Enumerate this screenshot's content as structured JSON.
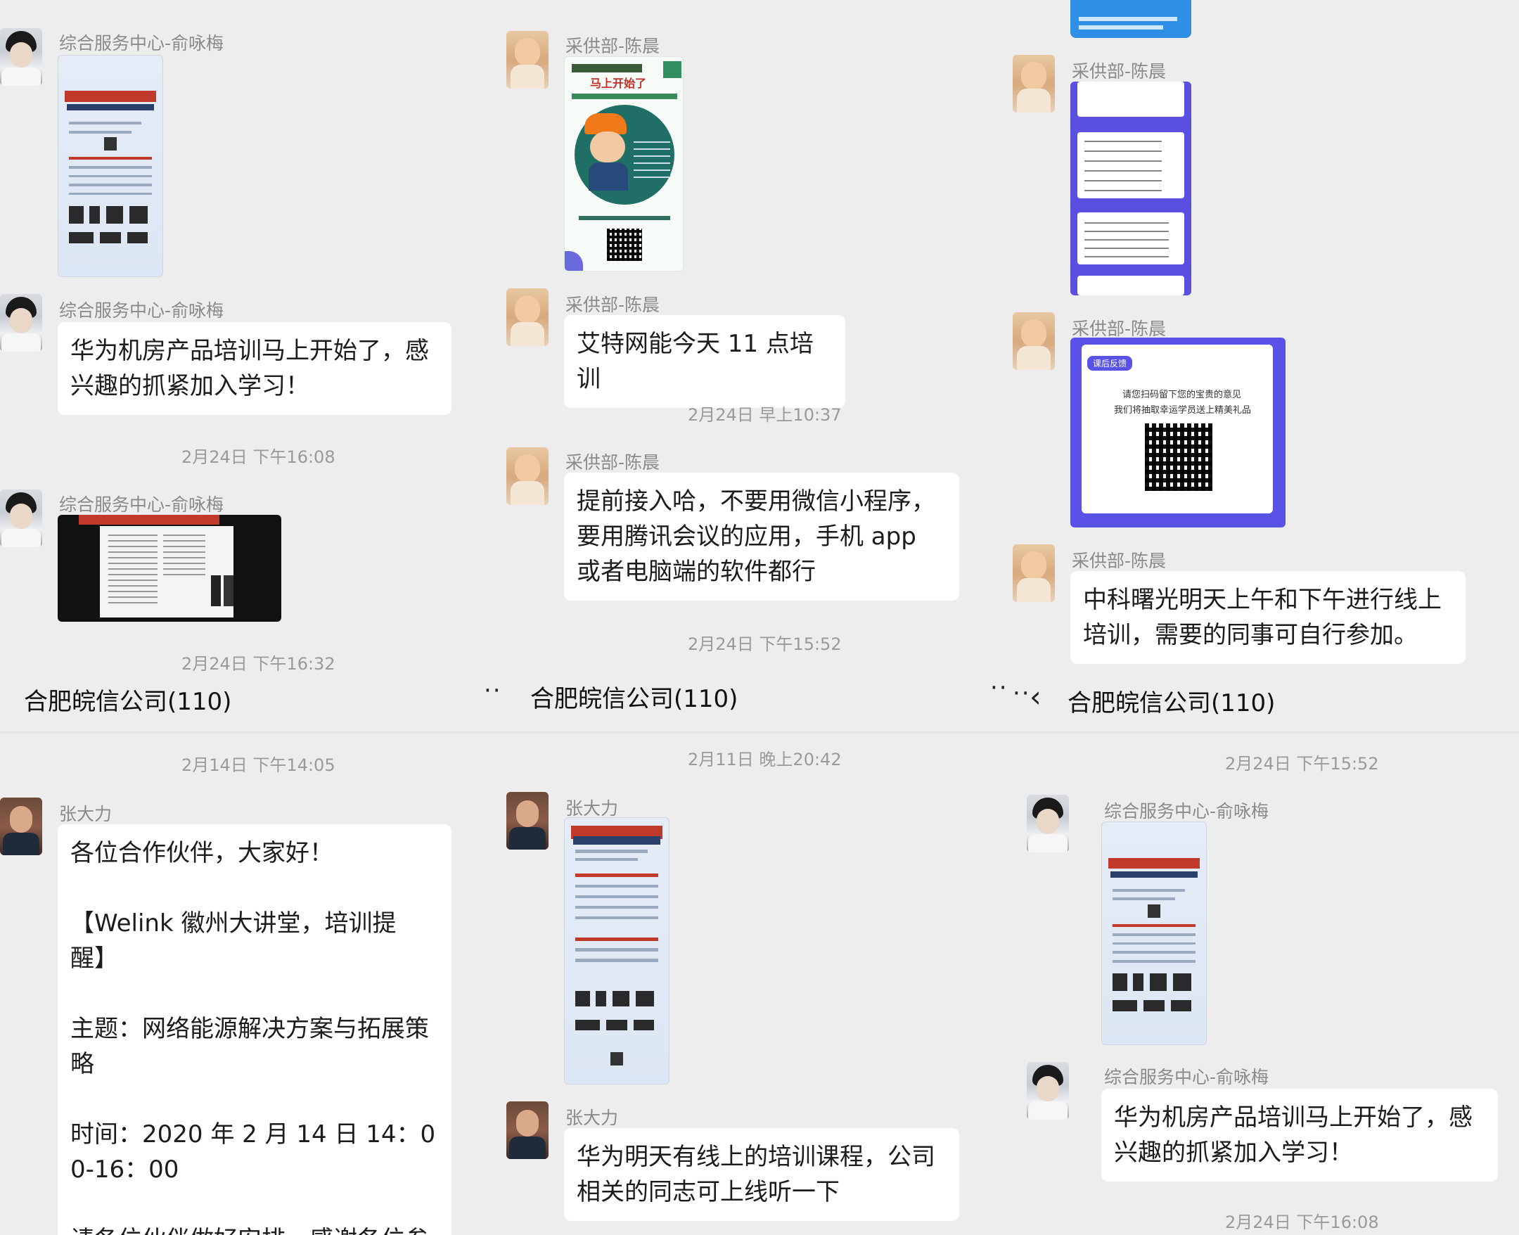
{
  "group_title": "合肥皖信公司(110)",
  "senders": {
    "yu": "综合服务中心-俞咏梅",
    "chen": "采供部-陈晨",
    "zhang": "张大力"
  },
  "panel_tl": {
    "msg_text": "华为机房产品培训马上开始了，感兴趣的抓紧加入学习！",
    "time1": "2月24日 下午16:08",
    "time2": "2月24日 下午16:32"
  },
  "panel_tm": {
    "msg1": "艾特网能今天 11 点培训",
    "time1": "2月24日 早上10:37",
    "msg2": "提前接入哈，不要用微信小程序，要用腾讯会议的应用，手机 app 或者电脑端的软件都行",
    "time2": "2月24日 下午15:52",
    "poster_title": "马上开始了"
  },
  "panel_tr": {
    "feedback_tag": "课后反馈",
    "feedback_line1": "请您扫码留下您的宝贵的意见",
    "feedback_line2": "我们将抽取幸运学员送上精美礼品",
    "msg": "中科曙光明天上午和下午进行线上培训，需要的同事可自行参加。"
  },
  "panel_bl": {
    "time": "2月14日 下午14:05",
    "msg": "各位合作伙伴，大家好！\n\n【Welink 徽州大讲堂，培训提醒】\n\n主题：网络能源解决方案与拓展策略\n\n时间：2020 年 2 月 14 日 14：00-16：00\n\n请各位伙伴做好安排，感谢各位参"
  },
  "panel_bm": {
    "time": "2月11日 晚上20:42",
    "msg": "华为明天有线上的培训课程，公司相关的同志可上线听一下"
  },
  "panel_br": {
    "time1": "2月24日 下午15:52",
    "msg": "华为机房产品培训马上开始了，感兴趣的抓紧加入学习！",
    "time2": "2月24日 下午16:08"
  },
  "icons": [
    "back-arrow-icon",
    "more-dots-icon"
  ]
}
